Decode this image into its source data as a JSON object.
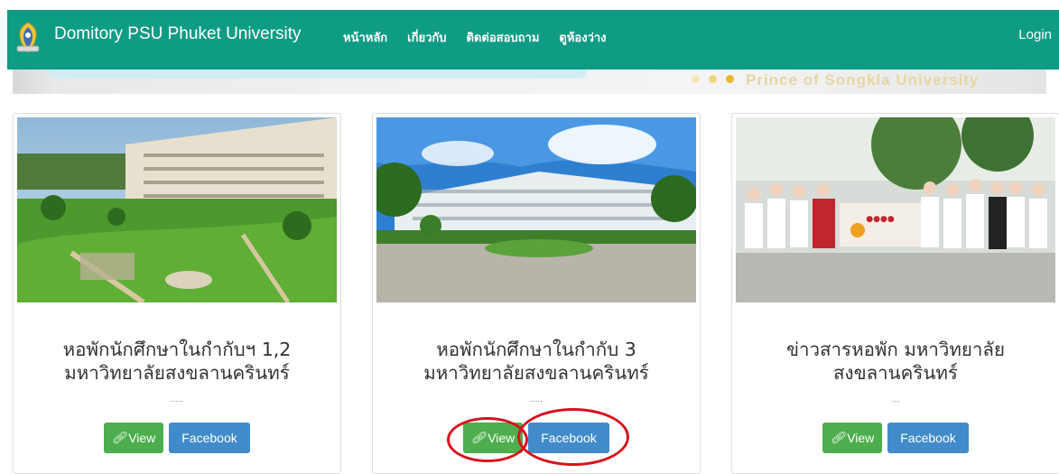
{
  "navbar": {
    "brand": "Domitory PSU Phuket University",
    "links": [
      {
        "label": "หน้าหลัก"
      },
      {
        "label": "เกี่ยวกับ"
      },
      {
        "label": "ติดต่อสอบถาม"
      },
      {
        "label": "ดูห้องว่าง"
      }
    ],
    "login": "Login",
    "color": "#0e9c84"
  },
  "banner": {
    "text": "Prince of Songkla University",
    "dot_colors": [
      "#f5e6b8",
      "#f0d67a",
      "#e8b830"
    ]
  },
  "cards": [
    {
      "title_line1": "หอพักนักศึกษาในกำกับฯ 1,2",
      "title_line2": "มหาวิทยาลัยสงขลานครินทร์",
      "excerpt": ".....",
      "view_label": "View",
      "facebook_label": "Facebook"
    },
    {
      "title_line1": "หอพักนักศึกษาในกำกับ 3",
      "title_line2": "มหาวิทยาลัยสงขลานครินทร์",
      "excerpt": ".....",
      "view_label": "View",
      "facebook_label": "Facebook"
    },
    {
      "title_line1": "ข่าวสารหอพัก มหาวิทยาลัย",
      "title_line2": "สงขลานครินทร์",
      "excerpt": "...",
      "view_label": "View",
      "facebook_label": "Facebook"
    }
  ],
  "colors": {
    "view_button": "#4cae4c",
    "facebook_button": "#428bca",
    "annotation": "#d8111c"
  }
}
